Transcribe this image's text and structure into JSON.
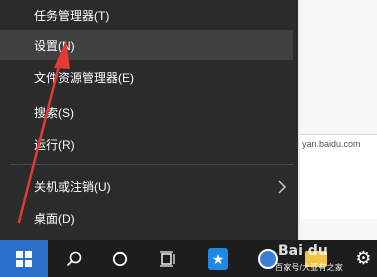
{
  "start_menu": {
    "items": [
      {
        "label": "任务管理器(T)"
      },
      {
        "label": "设置(N)"
      },
      {
        "label": "文件资源管理器(E)"
      },
      {
        "label": "搜索(S)"
      },
      {
        "label": "运行(R)"
      },
      {
        "label": "关机或注销(U)"
      },
      {
        "label": "桌面(D)"
      }
    ]
  },
  "taskbar": {
    "icons": [
      "windows-icon",
      "search-icon",
      "cortana-circle-icon",
      "task-view-icon",
      "app-icon",
      "browser-icon",
      "folder-icon",
      "settings-gear-icon"
    ]
  },
  "background": {
    "partial_text": "yan.baidu.com"
  },
  "watermark": {
    "logo_text": "Bai du",
    "caption": "百家号/大亚有之家"
  },
  "colors": {
    "menu_bg": "#2b2b2b",
    "menu_highlight": "#414141",
    "taskbar_bg": "#1d1d1d",
    "start_accent": "#2a6fc9",
    "arrow_red": "#e53935"
  }
}
